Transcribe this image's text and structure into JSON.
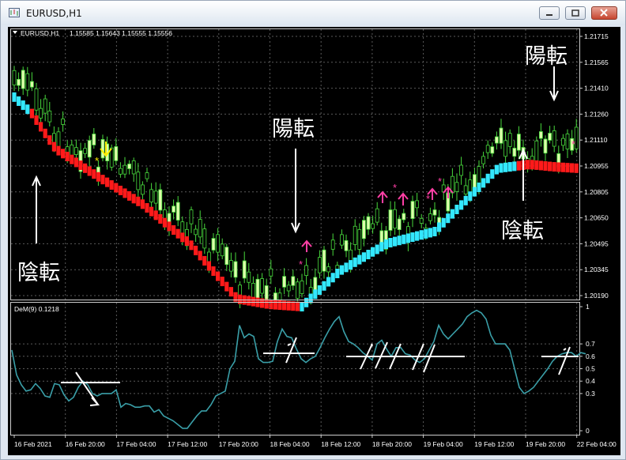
{
  "window": {
    "title": "EURUSD,H1"
  },
  "price_panel": {
    "header_symbol": "EURUSD,H1",
    "header_ohlc": "1.15585 1.15643 1.15555 1.15556",
    "y_ticks": [
      "1.21715",
      "1.21565",
      "1.21410",
      "1.21260",
      "1.21110",
      "1.20955",
      "1.20805",
      "1.20650",
      "1.20495",
      "1.20345",
      "1.20190"
    ],
    "annotations": [
      {
        "id": "yang1",
        "text": "陽転"
      },
      {
        "id": "yang2",
        "text": "陽転"
      },
      {
        "id": "in1",
        "text": "陰転"
      },
      {
        "id": "in2",
        "text": "陰転"
      }
    ]
  },
  "indicator_panel": {
    "label": "DeM(9) 0.1218",
    "y_ticks": [
      "1",
      "0.7",
      "0.6",
      "0.5",
      "0.4",
      "0.3",
      "0"
    ]
  },
  "x_ticks": [
    "16 Feb 2021",
    "16 Feb 20:00",
    "17 Feb 04:00",
    "17 Feb 12:00",
    "17 Feb 20:00",
    "18 Feb 04:00",
    "18 Feb 12:00",
    "18 Feb 20:00",
    "19 Feb 04:00",
    "19 Feb 12:00",
    "19 Feb 20:00",
    "22 Feb 04:00"
  ],
  "chart_data": {
    "type": "line",
    "series": [
      {
        "name": "DeM(9)",
        "x": [
          0,
          6,
          12,
          18,
          24,
          30,
          36,
          42,
          48,
          54,
          60,
          66,
          72,
          78,
          84,
          90,
          96,
          102,
          108,
          114,
          120,
          126,
          132,
          138,
          144,
          150,
          156,
          162,
          168,
          174,
          180,
          186,
          192,
          198,
          204,
          210,
          216,
          222,
          228,
          234,
          240,
          246,
          252,
          258,
          264,
          270,
          276,
          282,
          288,
          294,
          300,
          306,
          312,
          318,
          324,
          330,
          336,
          342,
          348,
          354,
          360,
          366,
          372,
          378,
          384,
          390,
          396,
          402,
          408,
          414,
          420,
          426,
          432,
          438,
          444,
          450,
          456,
          462,
          468,
          474,
          480,
          486,
          492,
          498,
          504,
          510,
          516,
          522,
          528,
          534,
          540,
          546,
          552,
          558,
          564,
          570,
          576,
          582,
          588,
          594,
          600,
          606,
          612,
          618,
          624,
          630,
          636,
          642,
          648,
          654,
          660,
          666,
          672,
          678,
          684,
          690,
          696,
          702,
          708,
          714,
          720,
          726
        ],
        "values": [
          0.65,
          0.45,
          0.37,
          0.32,
          0.33,
          0.38,
          0.34,
          0.28,
          0.27,
          0.38,
          0.37,
          0.29,
          0.24,
          0.27,
          0.35,
          0.4,
          0.37,
          0.3,
          0.28,
          0.3,
          0.3,
          0.3,
          0.33,
          0.19,
          0.22,
          0.21,
          0.19,
          0.19,
          0.2,
          0.2,
          0.15,
          0.17,
          0.12,
          0.1,
          0.08,
          0.05,
          0.02,
          0.02,
          0.07,
          0.12,
          0.16,
          0.16,
          0.21,
          0.28,
          0.3,
          0.32,
          0.5,
          0.56,
          0.85,
          0.75,
          0.78,
          0.76,
          0.58,
          0.55,
          0.55,
          0.56,
          0.72,
          0.82,
          0.76,
          0.75,
          0.66,
          0.58,
          0.55,
          0.58,
          0.6,
          0.67,
          0.75,
          0.82,
          0.88,
          0.92,
          0.8,
          0.72,
          0.7,
          0.67,
          0.63,
          0.6,
          0.57,
          0.7,
          0.73,
          0.66,
          0.6,
          0.67,
          0.67,
          0.62,
          0.61,
          0.57,
          0.55,
          0.58,
          0.65,
          0.72,
          0.85,
          0.78,
          0.74,
          0.78,
          0.82,
          0.86,
          0.92,
          0.95,
          0.97,
          0.95,
          0.9,
          0.77,
          0.7,
          0.7,
          0.7,
          0.65,
          0.5,
          0.35,
          0.3,
          0.32,
          0.35,
          0.4,
          0.45,
          0.5,
          0.56,
          0.6,
          0.62,
          0.63,
          0.63,
          0.6,
          0.63,
          0.62
        ],
        "color": "#3a9fa8"
      }
    ],
    "xlabel": "",
    "ylabel": "",
    "ylim": [
      0,
      1
    ],
    "grid": true,
    "candles_series_colors": {
      "up_body": "#ddffaa",
      "up_wick": "#48d93c",
      "down_body": "#000000",
      "heiken_bear": "#ff1a1a",
      "heiken_bull": "#33e8ff",
      "arrow_buy": "#ff3fa5",
      "arrow_sell": "#ffee00"
    }
  }
}
